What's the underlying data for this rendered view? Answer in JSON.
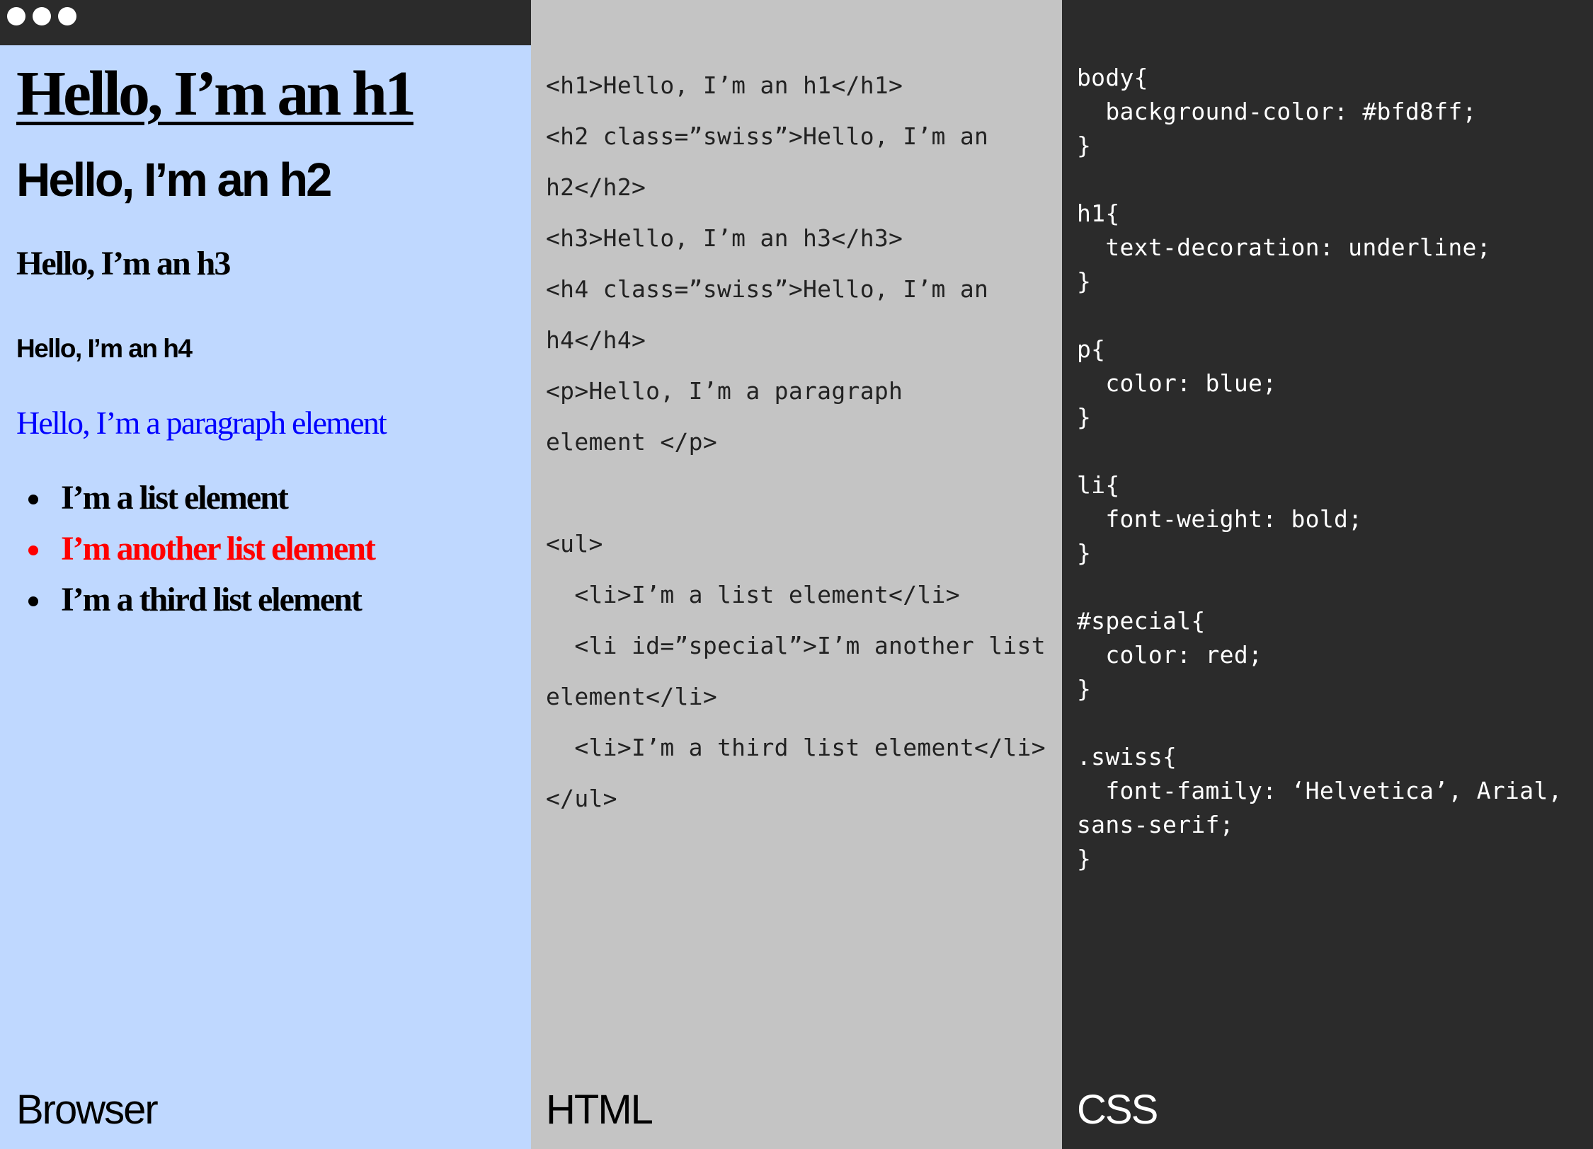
{
  "browser": {
    "caption": "Browser",
    "h1": "Hello, I’m an h1",
    "h2": "Hello, I’m an h2",
    "h3": "Hello, I’m an h3",
    "h4": "Hello, I’m an h4",
    "paragraph": "Hello, I’m a paragraph element",
    "list": [
      "I’m a list element",
      "I’m another list element",
      "I’m a third list element"
    ]
  },
  "html_panel": {
    "caption": "HTML",
    "lines": [
      "<h1>Hello, I’m an h1</h1>",
      "<h2 class=”swiss”>Hello, I’m an",
      "h2</h2>",
      "<h3>Hello, I’m an h3</h3>",
      "<h4 class=”swiss”>Hello, I’m an",
      "h4</h4>",
      "<p>Hello, I’m a paragraph",
      "element </p>",
      "",
      "<ul>",
      "  <li>I’m a list element</li>",
      "  <li id=”special”>I’m another list",
      "element</li>",
      "  <li>I’m a third list element</li>",
      "</ul>"
    ]
  },
  "css_panel": {
    "caption": "CSS",
    "lines": [
      "body{",
      "  background-color: #bfd8ff;",
      "}",
      "",
      "h1{",
      "  text-decoration: underline;",
      "}",
      "",
      "p{",
      "  color: blue;",
      "}",
      "",
      "li{",
      "  font-weight: bold;",
      "}",
      "",
      "#special{",
      "  color: red;",
      "}",
      "",
      ".swiss{",
      "  font-family: ‘Helvetica’, Arial,",
      "sans-serif;",
      "}"
    ]
  },
  "colors": {
    "browser_bg": "#bfd8ff",
    "html_bg": "#c4c4c4",
    "css_bg": "#2b2b2b",
    "paragraph": "#0000ff",
    "special": "#ff0000"
  },
  "icons": [
    "window-dot-icon",
    "window-dot-icon",
    "window-dot-icon"
  ]
}
